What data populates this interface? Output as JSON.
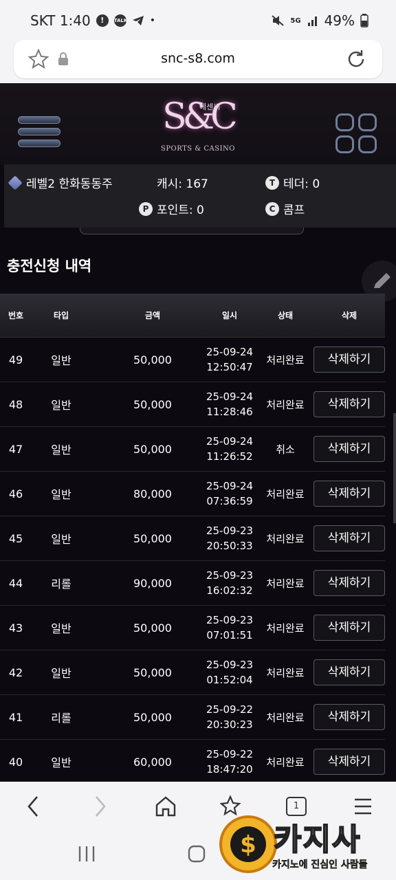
{
  "status_bar": {
    "carrier_time": "SKT 1:40",
    "battery": "49%"
  },
  "browser": {
    "url": "snc-s8.com"
  },
  "site": {
    "logo": {
      "mark": "S&C",
      "korean": "에센씨",
      "subtitle": "SPORTS & CASINO"
    },
    "info": {
      "level_user": "레벨2 한화동동주",
      "cash": "캐시: 167",
      "tether": "테더: 0",
      "points": "포인트: 0",
      "comp": "콤프"
    },
    "page_title": "충전신청 내역",
    "table": {
      "headers": [
        "번호",
        "타입",
        "금액",
        "일시",
        "상태",
        "삭제"
      ],
      "delete_label": "삭제하기",
      "rows": [
        {
          "no": "49",
          "type": "일반",
          "amount": "50,000",
          "date": "25-09-24",
          "time": "12:50:47",
          "status": "처리완료"
        },
        {
          "no": "48",
          "type": "일반",
          "amount": "50,000",
          "date": "25-09-24",
          "time": "11:28:46",
          "status": "처리완료"
        },
        {
          "no": "47",
          "type": "일반",
          "amount": "50,000",
          "date": "25-09-24",
          "time": "11:26:52",
          "status": "취소"
        },
        {
          "no": "46",
          "type": "일반",
          "amount": "80,000",
          "date": "25-09-24",
          "time": "07:36:59",
          "status": "처리완료"
        },
        {
          "no": "45",
          "type": "일반",
          "amount": "50,000",
          "date": "25-09-23",
          "time": "20:50:33",
          "status": "처리완료"
        },
        {
          "no": "44",
          "type": "리롤",
          "amount": "90,000",
          "date": "25-09-23",
          "time": "16:02:32",
          "status": "처리완료"
        },
        {
          "no": "43",
          "type": "일반",
          "amount": "50,000",
          "date": "25-09-23",
          "time": "07:01:51",
          "status": "처리완료"
        },
        {
          "no": "42",
          "type": "일반",
          "amount": "50,000",
          "date": "25-09-23",
          "time": "01:52:04",
          "status": "처리완료"
        },
        {
          "no": "41",
          "type": "리롤",
          "amount": "50,000",
          "date": "25-09-22",
          "time": "20:30:23",
          "status": "처리완료"
        },
        {
          "no": "40",
          "type": "일반",
          "amount": "60,000",
          "date": "25-09-22",
          "time": "18:47:20",
          "status": "처리완료"
        }
      ]
    }
  },
  "bottom_nav": {
    "tabs_count": "1"
  },
  "watermark": {
    "title": "카지사",
    "tagline": "카지노에 진심인 사람들"
  },
  "colors": {
    "site_bg": "#0c0a10",
    "header_bg": "#2e2d35",
    "accent_gold": "#f0b020"
  }
}
